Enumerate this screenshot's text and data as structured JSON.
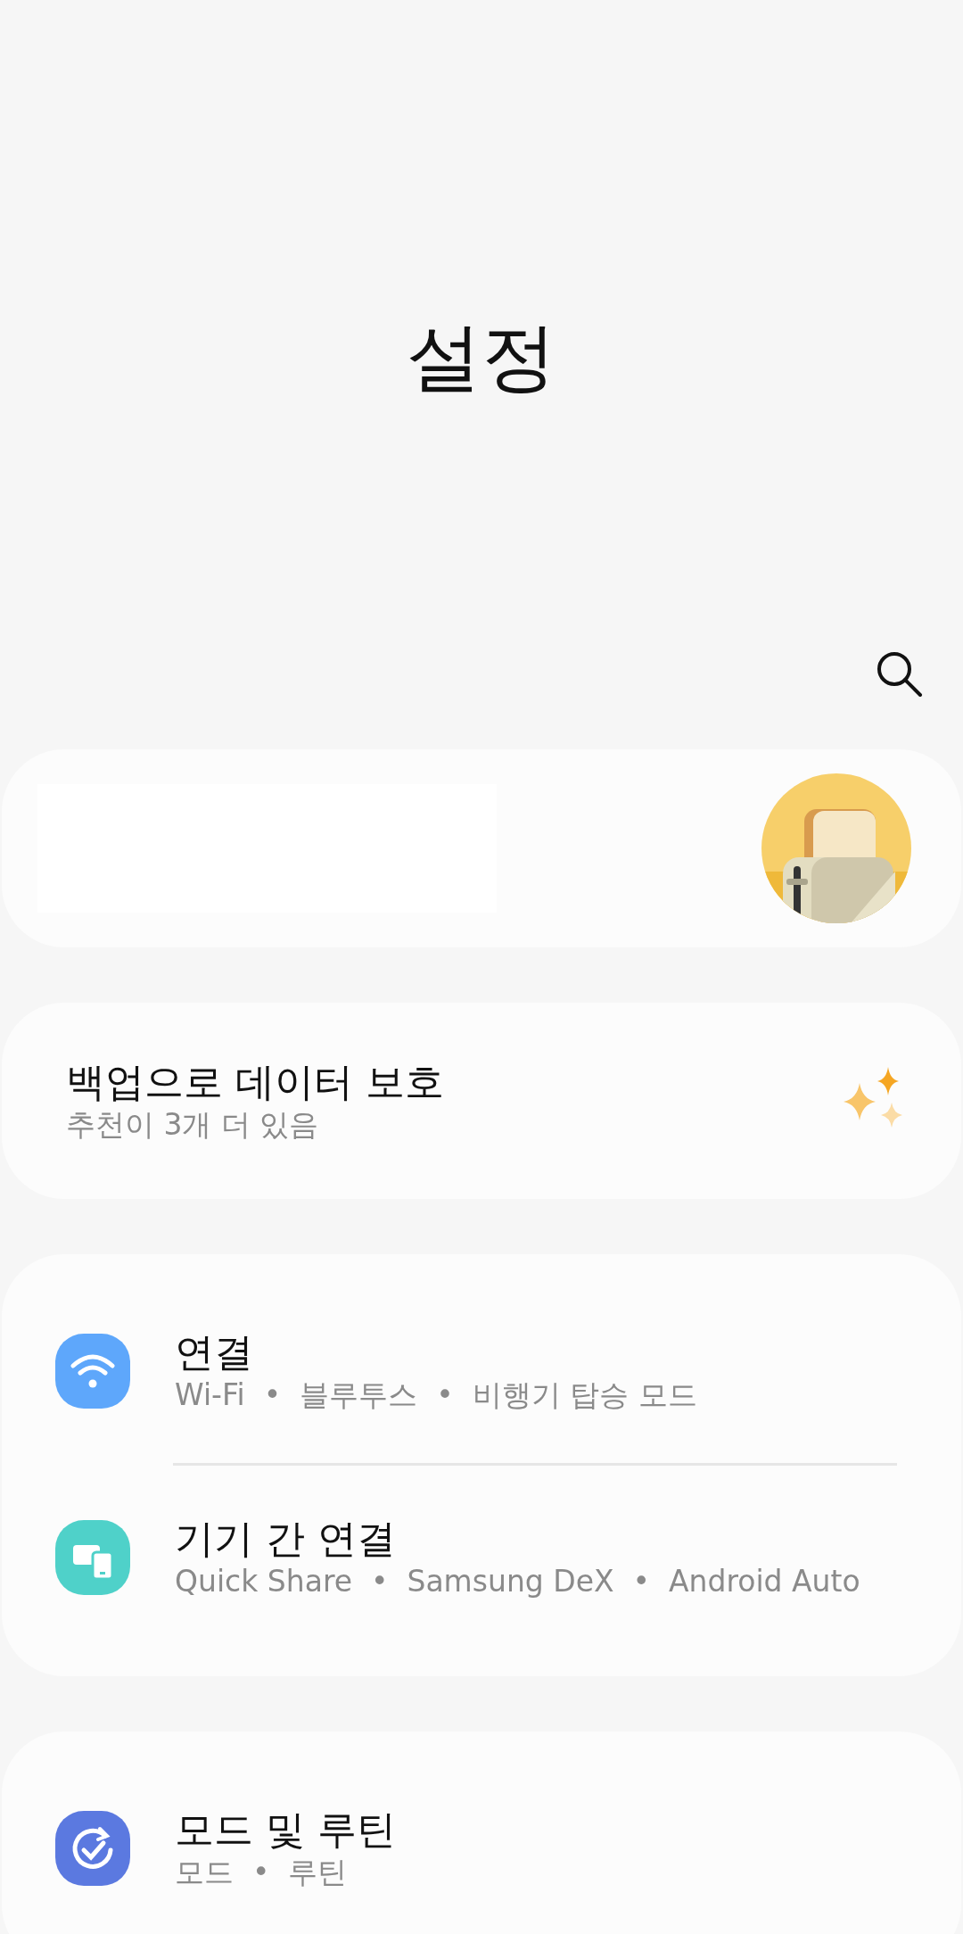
{
  "title": "설정",
  "suggestion": {
    "title": "백업으로 데이터 보호",
    "subtitle": "추천이 3개 더 있음"
  },
  "groups": [
    {
      "items": [
        {
          "kind": "wifi",
          "color": "#5ea7fb",
          "title": "연결",
          "subtitle": "Wi-Fi  •  블루투스  •  비행기 탑승 모드"
        },
        {
          "kind": "devices",
          "color": "#4fd1c9",
          "title": "기기 간 연결",
          "subtitle": "Quick Share  •  Samsung DeX  •  Android Auto"
        }
      ]
    },
    {
      "items": [
        {
          "kind": "routine",
          "color": "#5b79e0",
          "title": "모드 및 루틴",
          "subtitle": "모드  •  루틴"
        }
      ]
    }
  ]
}
